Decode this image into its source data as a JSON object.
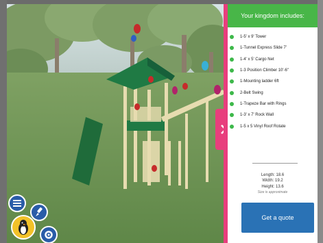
{
  "panel": {
    "header": "Your kingdom includes:",
    "items": [
      "1-5' x 9' Tower",
      "1-Tunnel Express Slide 7'",
      "1-4' x 5' Cargo Net",
      "1-3 Position Climber 10'-6\"",
      "1-Mounting ladder 6ft",
      "2-Belt Swing",
      "1-Trapeze Bar with Rings",
      "1-3' x 7' Rock Wall",
      "1-5 x 5 Vinyl Roof Rotate"
    ],
    "dimensions": {
      "length": "Length: 18.6",
      "width": "Width: 19.2",
      "height": "Height: 13.6",
      "note": "Size is approximate"
    },
    "quote_button": "Get a quote"
  },
  "colors": {
    "header_green": "#48b648",
    "accent_pink": "#e83e7d",
    "button_blue": "#2a72b5",
    "bullet_green": "#3db84a"
  },
  "icons": {
    "expand": "chevron-right-icon",
    "menu": "menu-icon",
    "brush": "paint-brush-icon",
    "settings": "gear-icon",
    "mascot": "penguin-mascot-icon"
  }
}
